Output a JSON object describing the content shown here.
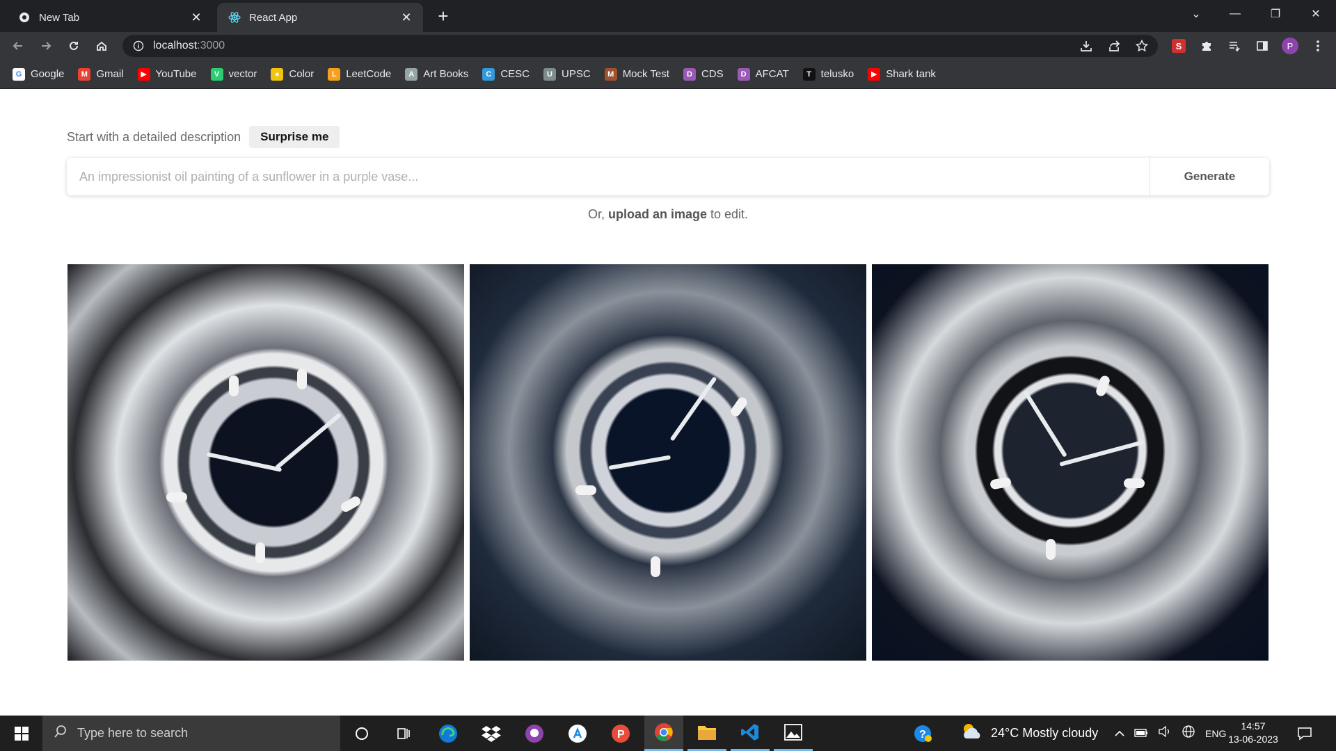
{
  "browser": {
    "tabs": [
      {
        "title": "New Tab",
        "favicon": "chrome-icon"
      },
      {
        "title": "React App",
        "favicon": "react-icon",
        "active": true
      }
    ],
    "url_host": "localhost",
    "url_port": ":3000",
    "bookmarks": [
      {
        "label": "Google",
        "icon": "google-icon",
        "color": "#ffffff",
        "glyph": "G"
      },
      {
        "label": "Gmail",
        "icon": "gmail-icon",
        "color": "#ea4335",
        "glyph": "M"
      },
      {
        "label": "YouTube",
        "icon": "youtube-icon",
        "color": "#ff0000",
        "glyph": "▶"
      },
      {
        "label": "vector",
        "icon": "vector-icon",
        "color": "#2ecc71",
        "glyph": "V"
      },
      {
        "label": "Color",
        "icon": "color-icon",
        "color": "#f1c40f",
        "glyph": "●"
      },
      {
        "label": "LeetCode",
        "icon": "leetcode-icon",
        "color": "#f89f1b",
        "glyph": "L"
      },
      {
        "label": "Art Books",
        "icon": "art-books-icon",
        "color": "#95a5a6",
        "glyph": "A"
      },
      {
        "label": "CESC",
        "icon": "cesc-icon",
        "color": "#3498db",
        "glyph": "C"
      },
      {
        "label": "UPSC",
        "icon": "upsc-icon",
        "color": "#7f8c8d",
        "glyph": "U"
      },
      {
        "label": "Mock Test",
        "icon": "mock-test-icon",
        "color": "#a0522d",
        "glyph": "M"
      },
      {
        "label": "CDS",
        "icon": "cds-icon",
        "color": "#9b59b6",
        "glyph": "D"
      },
      {
        "label": "AFCAT",
        "icon": "afcat-icon",
        "color": "#9b59b6",
        "glyph": "D"
      },
      {
        "label": "telusko",
        "icon": "telusko-icon",
        "color": "#111111",
        "glyph": "T"
      },
      {
        "label": "Shark tank",
        "icon": "youtube-icon",
        "color": "#ff0000",
        "glyph": "▶"
      }
    ]
  },
  "app": {
    "desc_label": "Start with a detailed description",
    "surprise_label": "Surprise me",
    "prompt_placeholder": "An impressionist oil painting of a sunflower in a purple vase...",
    "generate_label": "Generate",
    "or_prefix": "Or, ",
    "upload_link": "upload an image",
    "or_suffix": " to edit."
  },
  "taskbar": {
    "search_placeholder": "Type here to search",
    "weather": "24°C  Mostly cloudy",
    "language": "ENG",
    "time": "14:57",
    "date": "13-06-2023"
  }
}
